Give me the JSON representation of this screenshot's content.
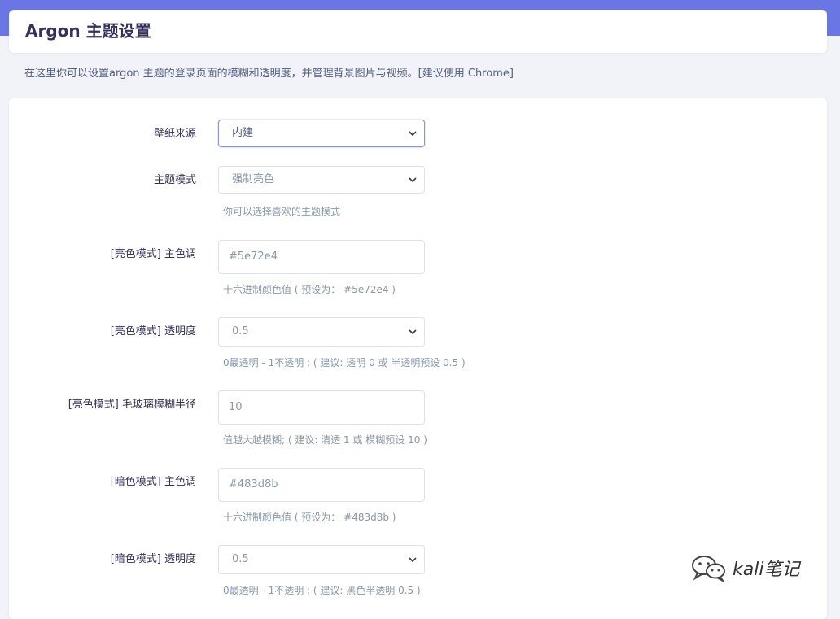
{
  "header": {
    "title": "Argon 主题设置"
  },
  "description": "在这里你可以设置argon 主题的登录页面的模糊和透明度，并管理背景图片与视频。[建议使用 Chrome]",
  "form": {
    "wallpaper_source": {
      "label": "壁纸来源",
      "value": "内建"
    },
    "theme_mode": {
      "label": "主题模式",
      "value": "强制亮色",
      "help": "你可以选择喜欢的主题模式"
    },
    "light_primary": {
      "label": "[亮色模式] 主色调",
      "value": "#5e72e4",
      "help": "十六进制颜色值 ( 预设为： #5e72e4 )"
    },
    "light_opacity": {
      "label": "[亮色模式] 透明度",
      "value": "0.5",
      "help": "0最透明 - 1不透明 ; ( 建议: 透明 0 或 半透明预设 0.5 )"
    },
    "light_blur": {
      "label": "[亮色模式] 毛玻璃模糊半径",
      "value": "10",
      "help": "值越大越模糊; ( 建议: 清透 1 或 模糊预设 10 )"
    },
    "dark_primary": {
      "label": "[暗色模式] 主色调",
      "value": "#483d8b",
      "help": "十六进制颜色值 ( 预设为： #483d8b )"
    },
    "dark_opacity": {
      "label": "[暗色模式] 透明度",
      "value": "0.5",
      "help": "0最透明 - 1不透明 ; ( 建议: 黑色半透明 0.5 )"
    }
  },
  "watermark": {
    "text": "kali笔记",
    "icon": "wechat-icon"
  },
  "colors": {
    "accent": "#6a76e4",
    "background": "#f1f3f8",
    "focus_border": "#8a94e8"
  }
}
